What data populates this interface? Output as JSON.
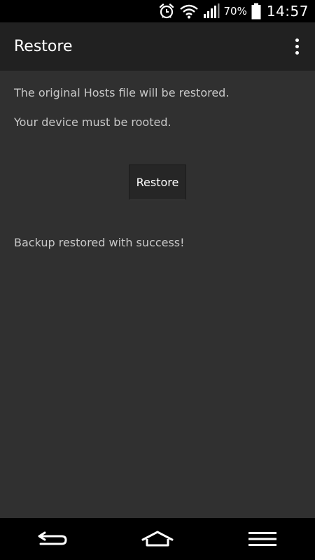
{
  "status_bar": {
    "battery_percent": "70%",
    "time": "14:57",
    "icons": [
      "alarm-icon",
      "wifi-icon",
      "signal-icon",
      "battery-icon"
    ]
  },
  "action_bar": {
    "title": "Restore",
    "overflow_icon": "overflow-menu-icon"
  },
  "content": {
    "line1": "The original Hosts file will be restored.",
    "line2": "Your device must be rooted.",
    "restore_button_label": "Restore",
    "result_message": "Backup restored with success!"
  },
  "nav_bar": {
    "icons": [
      "back-icon",
      "home-icon",
      "menu-icon"
    ]
  },
  "colors": {
    "background": "#303030",
    "action_bar": "#212121",
    "status_bar": "#000000",
    "text_primary": "#ffffff",
    "text_secondary": "#c8c8c8"
  }
}
